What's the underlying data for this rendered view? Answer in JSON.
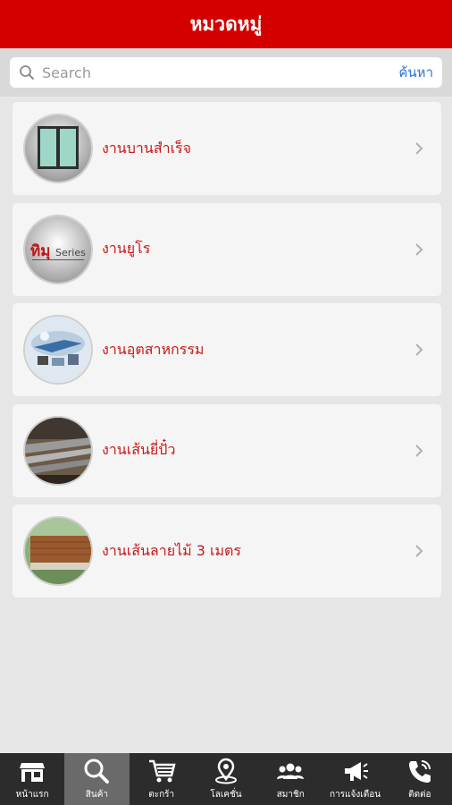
{
  "header": {
    "title": "หมวดหมู่"
  },
  "search": {
    "placeholder": "Search",
    "button_label": "ค้นหา"
  },
  "categories": [
    {
      "label": "งานบานสำเร็จ",
      "icon": "sliding-window-image"
    },
    {
      "label": "งานยูโร",
      "icon": "euro-series-logo-image"
    },
    {
      "label": "งานอุตสาหกรรม",
      "icon": "industrial-image"
    },
    {
      "label": "งานเส้นยี่ปั๋ว",
      "icon": "rail-track-image"
    },
    {
      "label": "งานเส้นลายไม้ 3 เมตร",
      "icon": "wood-fence-image"
    }
  ],
  "thumb_text": {
    "brand": "ทิมุ",
    "series": "Series"
  },
  "tabbar": {
    "active_index": 1,
    "items": [
      {
        "label": "หน้าแรก",
        "icon": "store-icon"
      },
      {
        "label": "สินค้า",
        "icon": "search-icon"
      },
      {
        "label": "ตะกร้า",
        "icon": "cart-icon"
      },
      {
        "label": "โลเคชั่น",
        "icon": "location-pin-icon"
      },
      {
        "label": "สมาชิก",
        "icon": "members-icon"
      },
      {
        "label": "การแจ้งเตือน",
        "icon": "megaphone-icon"
      },
      {
        "label": "ติดต่อ",
        "icon": "phone-icon"
      }
    ]
  },
  "colors": {
    "header": "#d40000",
    "label": "#c81818",
    "tabbar": "#2c2c2c",
    "active_tab": "#6a6a6a",
    "link": "#2a6fd6"
  }
}
